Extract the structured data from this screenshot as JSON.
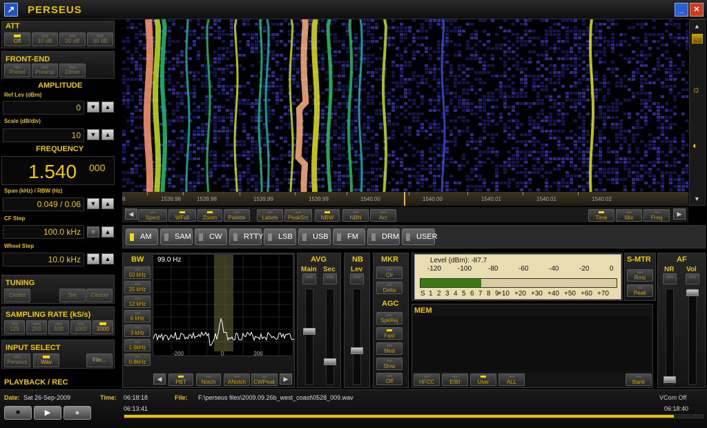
{
  "app": {
    "title": "PERSEUS"
  },
  "att": {
    "title": "ATT",
    "buttons": [
      {
        "label": "Off",
        "on": true
      },
      {
        "label": "10 dB",
        "on": false
      },
      {
        "label": "20 dB",
        "on": false
      },
      {
        "label": "30 dB",
        "on": false
      }
    ]
  },
  "frontend": {
    "title": "FRONT-END",
    "buttons": [
      {
        "label": "Presel",
        "on": false
      },
      {
        "label": "Preamp",
        "on": false
      },
      {
        "label": "Dither",
        "on": false
      }
    ]
  },
  "amplitude": {
    "title": "AMPLITUDE",
    "ref_label": "Ref Lev (dBm)",
    "ref_value": "0",
    "scale_label": "Scale (dB/div)",
    "scale_value": "10"
  },
  "frequency": {
    "title": "FREQUENCY",
    "main": "1.540",
    "sub": "000",
    "span_label": "Span (kHz) / RBW (Hz)",
    "span_value": "0.049 / 0.06",
    "cf_label": "CF Step",
    "cf_value": "100.0 kHz",
    "wheel_label": "Wheel Step",
    "wheel_value": "10.0 kHz"
  },
  "tuning": {
    "title": "TUNING",
    "buttons": [
      "Center",
      "Set",
      "Cancel"
    ]
  },
  "sampling": {
    "title": "SAMPLING RATE (kS/s)",
    "buttons": [
      {
        "label": "125",
        "on": false
      },
      {
        "label": "250",
        "on": false
      },
      {
        "label": "500",
        "on": false
      },
      {
        "label": "1000",
        "on": false
      },
      {
        "label": "2000",
        "on": true
      }
    ]
  },
  "input": {
    "title": "INPUT SELECT",
    "buttons": [
      {
        "label": "Perseus",
        "on": false
      },
      {
        "label": "Wav",
        "on": true
      }
    ],
    "file_button": "File..."
  },
  "playback": {
    "title": "PLAYBACK / REC"
  },
  "status": {
    "date_label": "Date:",
    "date": "Sat 26-Sep-2009",
    "time_label": "Time:",
    "time": "06:18:18",
    "file_label": "File:",
    "file": "F:\\perseus files\\2009.09.26b_west_coast\\0528_009.wav",
    "vcom": "VCom Off",
    "start": "06:13:41",
    "end": "06:18:40",
    "progress": 0.95
  },
  "waterfall": {
    "ticks": [
      "1539.98",
      "1539.98",
      "1539.99",
      "1539.99",
      "1540.00",
      "1540.00",
      "1540.01",
      "1540.01",
      "1540.02"
    ],
    "left_tick": "8"
  },
  "toolbar": {
    "left": [
      {
        "label": "Spect",
        "on": false
      },
      {
        "label": "WFall",
        "on": true
      },
      {
        "label": "Zoom",
        "on": true
      },
      {
        "label": "Palette",
        "on": false
      },
      {
        "label": "Labels",
        "on": false
      },
      {
        "label": "PeakSrc",
        "on": false
      },
      {
        "label": "NBW",
        "on": true
      },
      {
        "label": "NBN",
        "on": false
      },
      {
        "label": "Arc",
        "on": false
      }
    ],
    "right": [
      {
        "label": "Time",
        "on": true
      },
      {
        "label": "Mix",
        "on": false
      },
      {
        "label": "Freq",
        "on": false
      }
    ]
  },
  "modes": [
    {
      "label": "AM",
      "on": true
    },
    {
      "label": "SAM",
      "on": false
    },
    {
      "label": "CW",
      "on": false
    },
    {
      "label": "RTTY",
      "on": false
    },
    {
      "label": "LSB",
      "on": false
    },
    {
      "label": "USB",
      "on": false
    },
    {
      "label": "FM",
      "on": false
    },
    {
      "label": "DRM",
      "on": false
    },
    {
      "label": "USER",
      "on": false
    }
  ],
  "bw": {
    "title": "BW",
    "buttons": [
      "50 kHz",
      "25 kHz",
      "12 kHz",
      "6 kHz",
      "3 kHz",
      "1.6kHz",
      "0.8kHz"
    ],
    "display": "99.0 Hz",
    "ticks": [
      "-200",
      "0",
      "200"
    ],
    "bottom": [
      {
        "label": "PBT",
        "on": true
      },
      {
        "label": "Notch",
        "on": false
      },
      {
        "label": "ANotch",
        "on": false
      },
      {
        "label": "CWPeak",
        "on": false
      }
    ]
  },
  "avg": {
    "title": "AVG",
    "main": "Main",
    "sec": "Sec"
  },
  "nb": {
    "title": "NB",
    "lev": "Lev"
  },
  "mkr": {
    "title": "MKR",
    "buttons": [
      "Clr",
      "Delta"
    ]
  },
  "agc": {
    "title": "AGC",
    "buttons": [
      {
        "label": "SpkRej",
        "on": false
      },
      {
        "label": "Fast",
        "on": true
      },
      {
        "label": "Med",
        "on": false
      },
      {
        "label": "Slow",
        "on": false
      },
      {
        "label": "Off",
        "on": false
      }
    ]
  },
  "smeter": {
    "level_text": "Level (dBm): -87.7",
    "dbm_scale": [
      "-120",
      "-100",
      "-80",
      "-60",
      "-40",
      "-20",
      "0"
    ],
    "s_scale": [
      "S",
      "1",
      "2",
      "3",
      "4",
      "5",
      "6",
      "7",
      "8",
      "9",
      "+10",
      "+20",
      "+30",
      "+40",
      "+50",
      "+60",
      "+70"
    ],
    "bar_fraction": 0.31
  },
  "smtr": {
    "title": "S-MTR",
    "buttons": [
      "Rms",
      "Peak"
    ]
  },
  "af": {
    "title": "AF",
    "nr": "NR",
    "vol": "Vol"
  },
  "mem": {
    "title": "MEM",
    "buttons": [
      {
        "label": "HFCC",
        "on": false
      },
      {
        "label": "EIBI",
        "on": false
      },
      {
        "label": "User",
        "on": true
      },
      {
        "label": "ALL",
        "on": false
      }
    ],
    "bank": "Bank"
  }
}
